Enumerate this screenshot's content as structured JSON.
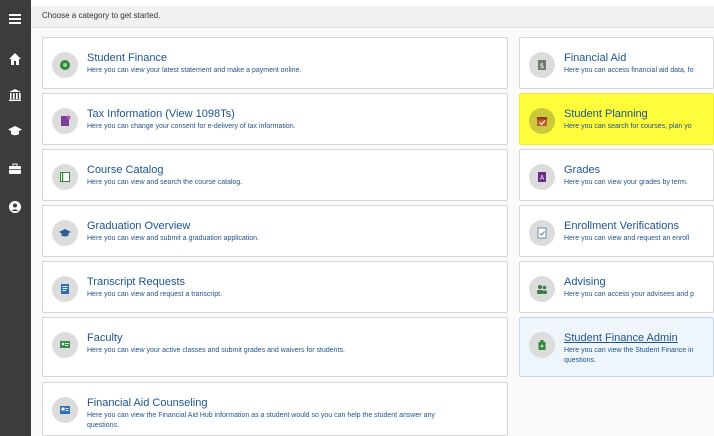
{
  "header": {
    "prompt": "Choose a category to get started."
  },
  "sidebar": {
    "items": [
      {
        "icon": "hamburger-menu-icon"
      },
      {
        "icon": "home-icon"
      },
      {
        "icon": "bank-icon"
      },
      {
        "icon": "graduation-cap-icon"
      },
      {
        "icon": "briefcase-icon"
      },
      {
        "icon": "user-circle-icon"
      }
    ]
  },
  "cards": {
    "student_finance": {
      "title": "Student Finance",
      "desc": "Here you can view your latest statement and make a payment online."
    },
    "financial_aid": {
      "title": "Financial Aid",
      "desc": "Here you can access financial aid data, fo"
    },
    "tax_information": {
      "title": "Tax Information (View 1098Ts)",
      "desc": "Here you can change your consent for e-delivery of tax information."
    },
    "student_planning": {
      "title": "Student Planning",
      "desc": "Here you can search for courses, plan yo"
    },
    "course_catalog": {
      "title": "Course Catalog",
      "desc": "Here you can view and search the course catalog."
    },
    "grades": {
      "title": "Grades",
      "desc": "Here you can view your grades by term."
    },
    "graduation_overview": {
      "title": "Graduation Overview",
      "desc": "Here you can view and submit a graduation application."
    },
    "enrollment_verifications": {
      "title": "Enrollment Verifications",
      "desc": "Here you can view and request an enroll"
    },
    "transcript_requests": {
      "title": "Transcript Requests",
      "desc": "Here you can view and request a transcript."
    },
    "advising": {
      "title": "Advising",
      "desc": "Here you can access your advisees and p"
    },
    "faculty": {
      "title": "Faculty",
      "desc": "Here you can view your active classes and submit grades and waivers for students."
    },
    "student_finance_admin": {
      "title": "Student Finance Admin",
      "desc_line1": "Here you can view the Student Finance in",
      "desc_line2": "questions."
    },
    "financial_aid_counseling": {
      "title": "Financial Aid Counseling",
      "desc_line1": "Here you can view the Financial Aid Hub information as a student would so you can help the student answer any",
      "desc_line2": "questions."
    }
  },
  "colors": {
    "highlight": "#fdfd3c",
    "link": "#1f5390",
    "sidebar": "#3c3c3c"
  }
}
